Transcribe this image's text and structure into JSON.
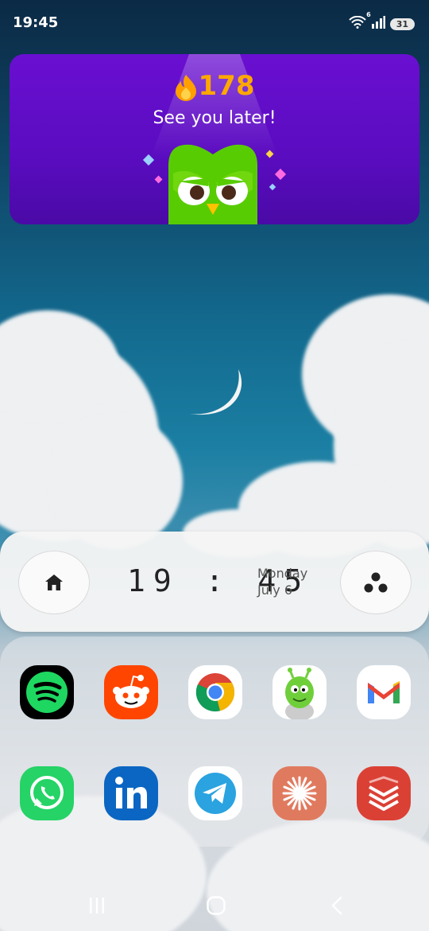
{
  "status_bar": {
    "time": "19:45",
    "wifi_badge": "6",
    "battery": "31"
  },
  "duolingo_widget": {
    "streak_count": "178",
    "message": "See you later!",
    "colors": {
      "background": "#5a0cc0",
      "streak": "#ffa800",
      "owl": "#58cc02"
    }
  },
  "clock_dock": {
    "time": "19 : 45",
    "day": "Monday",
    "date": "July 6",
    "left_button_icon": "home-icon",
    "right_button_icon": "three-dots-icon"
  },
  "apps": [
    {
      "name": "Spotify",
      "icon": "spotify-icon"
    },
    {
      "name": "Reddit",
      "icon": "reddit-icon"
    },
    {
      "name": "Chrome",
      "icon": "chrome-icon"
    },
    {
      "name": "Alien game",
      "icon": "green-alien-icon"
    },
    {
      "name": "Gmail",
      "icon": "gmail-icon"
    },
    {
      "name": "WhatsApp",
      "icon": "whatsapp-icon"
    },
    {
      "name": "LinkedIn",
      "icon": "linkedin-icon"
    },
    {
      "name": "Telegram",
      "icon": "telegram-icon"
    },
    {
      "name": "Starburst app",
      "icon": "starburst-icon"
    },
    {
      "name": "Todoist",
      "icon": "todoist-icon"
    }
  ],
  "nav_bar": {
    "recents_icon": "recents-icon",
    "home_icon": "home-circle-icon",
    "back_icon": "back-chevron-icon"
  }
}
